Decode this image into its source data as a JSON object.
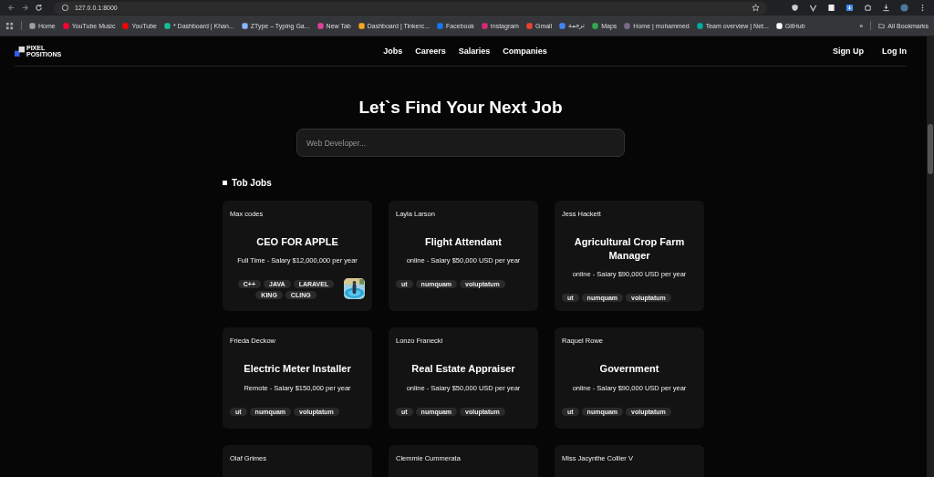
{
  "browser": {
    "address": "127.0.0.1:8000",
    "bookmarks": [
      {
        "label": "Home",
        "color": "#9aa0a6"
      },
      {
        "label": "YouTube Music",
        "color": "#ff0033"
      },
      {
        "label": "YouTube",
        "color": "#ff0000"
      },
      {
        "label": "* Dashboard | Khan...",
        "color": "#14bf96"
      },
      {
        "label": "ZType – Typing Ga...",
        "color": "#8ab4f8"
      },
      {
        "label": "New Tab",
        "color": "#e040a0"
      },
      {
        "label": "Dashboard | Tinkerc...",
        "color": "#f5a623"
      },
      {
        "label": "Facebook",
        "color": "#1877f2"
      },
      {
        "label": "Instagram",
        "color": "#d62976"
      },
      {
        "label": "Gmail",
        "color": "#ea4335"
      },
      {
        "label": "ترجمة",
        "color": "#4285f4"
      },
      {
        "label": "Maps",
        "color": "#34a853"
      },
      {
        "label": "Home | mohammed",
        "color": "#7a6a8a"
      },
      {
        "label": "Team overview | Net...",
        "color": "#00ad9f"
      },
      {
        "label": "GitHub",
        "color": "#ffffff"
      }
    ],
    "more": "»",
    "all_bookmarks": "All Bookmarks"
  },
  "nav": {
    "logo": [
      "PIXEL",
      "POSITIONS"
    ],
    "links": [
      "Jobs",
      "Careers",
      "Salaries",
      "Companies"
    ],
    "auth": [
      "Sign Up",
      "Log In"
    ]
  },
  "heading": "Let`s Find Your Next Job",
  "search": {
    "placeholder": "Web Developer..."
  },
  "section_title": "Tob Jobs",
  "jobs": [
    {
      "employer": "Max codes",
      "title": "CEO FOR APPLE",
      "salary": "Full Time - Salary $12,000,000 per year",
      "tags": [
        "C++",
        "JAVA",
        "LARAVEL",
        "KING",
        "CLING"
      ],
      "has_logo": true
    },
    {
      "employer": "Layla Larson",
      "title": "Flight Attendant",
      "salary": "online - Salary $50,000 USD per year",
      "tags": [
        "ut",
        "numquam",
        "voluptatum"
      ]
    },
    {
      "employer": "Jess Hackett",
      "title": "Agricultural Crop Farm Manager",
      "salary": "online - Salary $90,000 USD per year",
      "tags": [
        "ut",
        "numquam",
        "voluptatum"
      ]
    },
    {
      "employer": "Frieda Deckow",
      "title": "Electric Meter Installer",
      "salary": "Remote - Salary $150,000 per year",
      "tags": [
        "ut",
        "numquam",
        "voluptatum"
      ]
    },
    {
      "employer": "Lonzo Franecki",
      "title": "Real Estate Appraiser",
      "salary": "online - Salary $50,000 USD per year",
      "tags": [
        "ut",
        "numquam",
        "voluptatum"
      ]
    },
    {
      "employer": "Raquel Rowe",
      "title": "Government",
      "salary": "online - Salary $90,000 USD per year",
      "tags": [
        "ut",
        "numquam",
        "voluptatum"
      ]
    },
    {
      "employer": "Olaf Grimes"
    },
    {
      "employer": "Clemmie Cummerata"
    },
    {
      "employer": "Miss Jacynthe Collier V"
    }
  ]
}
